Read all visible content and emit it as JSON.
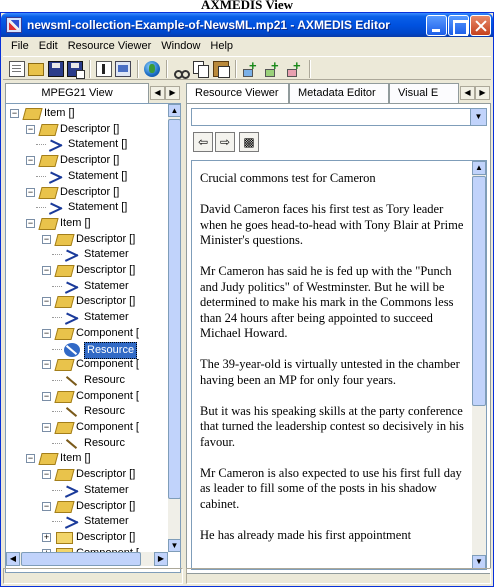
{
  "caption": "AXMEDIS View",
  "window": {
    "title": "newsml-collection-Example-of-NewsML.mp21 - AXMEDIS Editor"
  },
  "menu": [
    "File",
    "Edit",
    "Resource Viewer",
    "Window",
    "Help"
  ],
  "left_pane": {
    "tab": "MPEG21 View",
    "tree": [
      {
        "label": "Item []",
        "kind": "folder-open"
      },
      {
        "label": "Descriptor []",
        "kind": "folder-open"
      },
      {
        "label": "Statement []",
        "kind": "statement"
      },
      {
        "label": "Descriptor []",
        "kind": "folder-open"
      },
      {
        "label": "Statement []",
        "kind": "statement"
      },
      {
        "label": "Descriptor []",
        "kind": "folder-open"
      },
      {
        "label": "Statement []",
        "kind": "statement"
      },
      {
        "label": "Item []",
        "kind": "folder-open"
      },
      {
        "label": "Descriptor []",
        "kind": "folder-open"
      },
      {
        "label": "Statemer",
        "kind": "statement"
      },
      {
        "label": "Descriptor []",
        "kind": "folder-open"
      },
      {
        "label": "Statemer",
        "kind": "statement"
      },
      {
        "label": "Descriptor []",
        "kind": "folder-open"
      },
      {
        "label": "Statemer",
        "kind": "statement"
      },
      {
        "label": "Component [",
        "kind": "folder-open"
      },
      {
        "label": "Resource",
        "kind": "resource-selected"
      },
      {
        "label": "Component [",
        "kind": "folder-open"
      },
      {
        "label": "Resourc",
        "kind": "resource"
      },
      {
        "label": "Component [",
        "kind": "folder-open"
      },
      {
        "label": "Resourc",
        "kind": "resource"
      },
      {
        "label": "Component [",
        "kind": "folder-open"
      },
      {
        "label": "Resourc",
        "kind": "resource"
      },
      {
        "label": "Item []",
        "kind": "folder-open"
      },
      {
        "label": "Descriptor []",
        "kind": "folder-open"
      },
      {
        "label": "Statemer",
        "kind": "statement"
      },
      {
        "label": "Descriptor []",
        "kind": "folder-open"
      },
      {
        "label": "Statemer",
        "kind": "statement"
      },
      {
        "label": "Descriptor []",
        "kind": "folder-closed"
      },
      {
        "label": "Component [",
        "kind": "folder-closed"
      }
    ]
  },
  "right_pane": {
    "tabs": [
      "Resource Viewer",
      "Metadata Editor",
      "Visual E"
    ],
    "combo_value": "",
    "paragraphs": [
      "Crucial commons test for Cameron",
      "David Cameron faces his first test as Tory leader when he goes head-to-head with Tony Blair at Prime Minister's questions.",
      "Mr Cameron has said he is fed up with the \"Punch and Judy politics\" of Westminster. But he will be determined to make his mark in the Commons less than 24 hours after being appointed to succeed Michael Howard.",
      "The 39-year-old is virtually untested in the chamber having been an MP for only four years.",
      "But it was his speaking skills at the party conference that turned the leadership contest so decisively in his favour.",
      "Mr Cameron is also expected to use his first full day as leader to fill some of the posts in his shadow cabinet.",
      "He has already made his first appointment"
    ]
  },
  "colors": {
    "titlebar": "#0052e0",
    "selection": "#316ac5",
    "window_bg": "#ece9d8"
  },
  "icons": [
    "app-icon",
    "minimize-icon",
    "maximize-icon",
    "close-icon",
    "new-doc-icon",
    "open-folder-icon",
    "save-icon",
    "save-as-icon",
    "properties-icon",
    "sheet-icon",
    "globe-icon",
    "cut-icon",
    "copy-icon",
    "paste-icon",
    "add-item-icon",
    "add-descriptor-icon",
    "add-component-icon",
    "back-arrow-icon",
    "forward-arrow-icon",
    "refresh-icon"
  ]
}
